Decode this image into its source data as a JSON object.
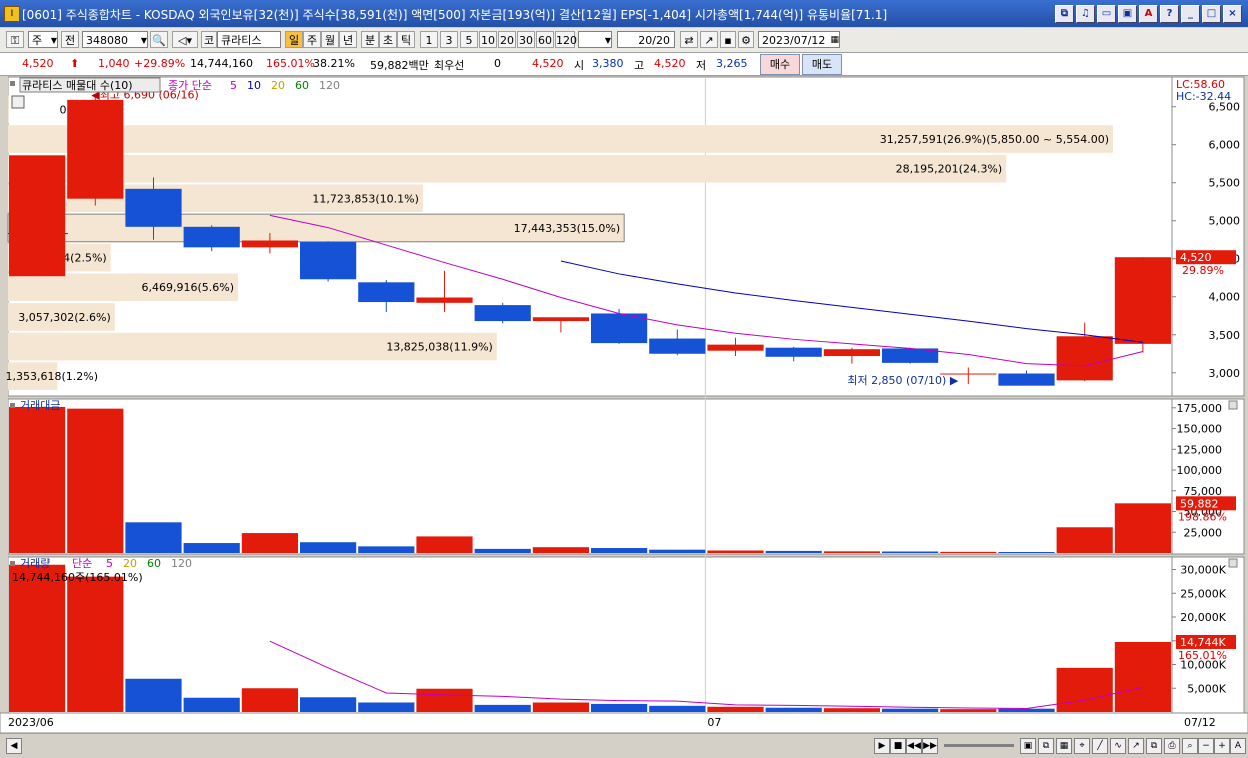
{
  "window": {
    "app_icon": "I",
    "title": "[0601] 주식종합차트 - KOSDAQ 외국인보유[32(천)] 주식수[38,591(천)] 액면[500] 자본금[193(억)] 결산[12월] EPS[-1,404] 시가총액[1,744(억)] 유통비율[71.1]",
    "buttons": [
      "⧉",
      "♫",
      "▭",
      "▣",
      "A",
      "?",
      "_",
      "□",
      "×"
    ]
  },
  "toolbar": {
    "mode": "주",
    "prev": "전",
    "code": "348080",
    "market": "코",
    "name": "큐라티스",
    "periods": [
      "일",
      "주",
      "월",
      "년",
      "분",
      "초",
      "틱"
    ],
    "selected_period": "일",
    "intervals": [
      "1",
      "3",
      "5",
      "10",
      "20",
      "30",
      "60",
      "120"
    ],
    "count": "20",
    "count_total": "/20",
    "date": "2023/07/12"
  },
  "quote": {
    "price": "4,520",
    "change": "1,040",
    "change_pct": "+29.89%",
    "volume": "14,744,160",
    "vol_ratio": "165.01%",
    "turnover": "38.21%",
    "amount": "59,882백만",
    "pref_label": "최우선",
    "pref_value": "0",
    "pref_price": "4,520",
    "open_label": "시",
    "open": "3,380",
    "high_label": "고",
    "high": "4,520",
    "low_label": "저",
    "low": "3,265",
    "buy": "매수",
    "sell": "매도"
  },
  "chart_data": {
    "type": "candlestick",
    "price_panel": {
      "legend_name": "큐라티스 매물대 수(10)",
      "legend_ma": "종가 단순",
      "ma_periods": [
        "5",
        "10",
        "20",
        "60",
        "120"
      ],
      "ma_colors": [
        "#c000c0",
        "#0000c0",
        "#c0a000",
        "#008000",
        "#808080"
      ],
      "lc": "LC:58.60",
      "hc": "HC:-32.44",
      "ylim": [
        2760,
        6720
      ],
      "yticks": [
        3000,
        3500,
        4000,
        4500,
        5000,
        5500,
        6000,
        6500
      ],
      "ytick_labels": [
        "3,000",
        "3,500",
        "4,000",
        "4,500",
        "5,000",
        "5,500",
        "6,000",
        "6,500"
      ],
      "candles": [
        {
          "o": 4270,
          "h": 4600,
          "l": 4270,
          "c": 5860
        },
        {
          "o": 5290,
          "h": 6660,
          "l": 5200,
          "c": 6590
        },
        {
          "o": 5420,
          "h": 5570,
          "l": 4750,
          "c": 4920
        },
        {
          "o": 4920,
          "h": 4940,
          "l": 4600,
          "c": 4650
        },
        {
          "o": 4650,
          "h": 4840,
          "l": 4570,
          "c": 4740
        },
        {
          "o": 4720,
          "h": 4730,
          "l": 4200,
          "c": 4230
        },
        {
          "o": 4190,
          "h": 4220,
          "l": 3800,
          "c": 3930
        },
        {
          "o": 3920,
          "h": 4340,
          "l": 3800,
          "c": 3990
        },
        {
          "o": 3890,
          "h": 3920,
          "l": 3650,
          "c": 3680
        },
        {
          "o": 3680,
          "h": 3720,
          "l": 3530,
          "c": 3730
        },
        {
          "o": 3780,
          "h": 3840,
          "l": 3380,
          "c": 3390
        },
        {
          "o": 3450,
          "h": 3570,
          "l": 3230,
          "c": 3250
        },
        {
          "o": 3290,
          "h": 3460,
          "l": 3220,
          "c": 3370
        },
        {
          "o": 3330,
          "h": 3340,
          "l": 3150,
          "c": 3210
        },
        {
          "o": 3220,
          "h": 3330,
          "l": 3120,
          "c": 3310
        },
        {
          "o": 3320,
          "h": 3330,
          "l": 3120,
          "c": 3130
        },
        {
          "o": 2990,
          "h": 3070,
          "l": 2850,
          "c": 2990
        },
        {
          "o": 2990,
          "h": 3030,
          "l": 2870,
          "c": 2830
        },
        {
          "o": 2900,
          "h": 3660,
          "l": 2890,
          "c": 3480
        },
        {
          "o": 3380,
          "h": 4520,
          "l": 3265,
          "c": 4520
        }
      ],
      "ma5": [
        null,
        null,
        null,
        null,
        5070,
        4910,
        4680,
        4450,
        4230,
        3990,
        3780,
        3630,
        3520,
        3440,
        3380,
        3320,
        3240,
        3120,
        3090,
        3280
      ],
      "ma10": [
        null,
        null,
        null,
        null,
        null,
        null,
        null,
        null,
        null,
        4470,
        4300,
        4170,
        4050,
        3950,
        3860,
        3770,
        3680,
        3580,
        3500,
        3400
      ],
      "volume_profile": [
        {
          "label": "1,353,618(1.2%)",
          "low": 2760,
          "high": 3150,
          "pct": 1.2
        },
        {
          "label": "13,825,038(11.9%)",
          "low": 3150,
          "high": 3540,
          "pct": 11.9
        },
        {
          "label": "3,057,302(2.6%)",
          "low": 3540,
          "high": 3930,
          "pct": 2.6
        },
        {
          "label": "6,469,916(5.6%)",
          "low": 3930,
          "high": 4320,
          "pct": 5.6
        },
        {
          "label": "2,940,844(2.5%)",
          "low": 4320,
          "high": 4710,
          "pct": 2.5
        },
        {
          "label": "17,443,353(15.0%)",
          "low": 4710,
          "high": 5100,
          "pct": 15.0
        },
        {
          "label": "11,723,853(10.1%)",
          "low": 5100,
          "high": 5490,
          "pct": 10.1
        },
        {
          "label": "28,195,201(24.3%)",
          "low": 5490,
          "high": 5880,
          "pct": 24.3
        },
        {
          "label": "31,257,591(26.9%)(5,850.00 ~ 5,554.00)",
          "low": 5880,
          "high": 6270,
          "pct": 26.9
        },
        {
          "label": "0(0.0%)",
          "low": 6270,
          "high": 6660,
          "pct": 0.0
        }
      ],
      "high_marker": "최고 6,690 (06/16)",
      "low_marker": "최저 2,850 (07/10)",
      "current_price": "4,520",
      "current_pct": "29.89%"
    },
    "amount_panel": {
      "legend_name": "거래대금",
      "ylim": [
        0,
        182000
      ],
      "yticks": [
        25000,
        50000,
        75000,
        100000,
        125000,
        150000,
        175000
      ],
      "ytick_labels": [
        "25,000",
        "50,000",
        "75,000",
        "100,000",
        "125,000",
        "150,000",
        "175,000"
      ],
      "values": [
        176000,
        174000,
        37000,
        12000,
        24000,
        13000,
        8000,
        20000,
        5000,
        7000,
        6000,
        4000,
        3000,
        2500,
        2000,
        1800,
        1400,
        1200,
        31000,
        59882
      ],
      "current": "59,882",
      "current_pct": "198.86%"
    },
    "volume_panel": {
      "legend_name": "거래량",
      "legend_ma": "단순",
      "ma_periods": [
        "5",
        "20",
        "60",
        "120"
      ],
      "ma_colors": [
        "#c000c0",
        "#c0a000",
        "#008000",
        "#808080"
      ],
      "annotation": "14,744,160주(165.01%)",
      "ylim": [
        0,
        32000
      ],
      "yticks": [
        5000,
        10000,
        15000,
        20000,
        25000,
        30000
      ],
      "ytick_labels": [
        "5,000K",
        "10,000K",
        "15,000K",
        "20,000K",
        "25,000K",
        "30,000K"
      ],
      "values": [
        31000,
        28500,
        7000,
        3000,
        5000,
        3100,
        2000,
        4900,
        1500,
        2000,
        1700,
        1300,
        1100,
        900,
        800,
        700,
        600,
        700,
        9300,
        14744
      ],
      "ma5": [
        null,
        null,
        null,
        null,
        14900,
        9300,
        4000,
        3600,
        3300,
        2700,
        2400,
        2300,
        1500,
        1400,
        1200,
        1000,
        850,
        750,
        2500,
        5200
      ],
      "current": "14,744K",
      "current_pct": "165.01%"
    },
    "x_labels": [
      {
        "index": 0,
        "label": "2023/06"
      },
      {
        "index": 12,
        "label": "07"
      }
    ],
    "x_right_label": "07/12",
    "candle_up_color": "#e31b0a",
    "candle_down_color": "#1652d6"
  }
}
